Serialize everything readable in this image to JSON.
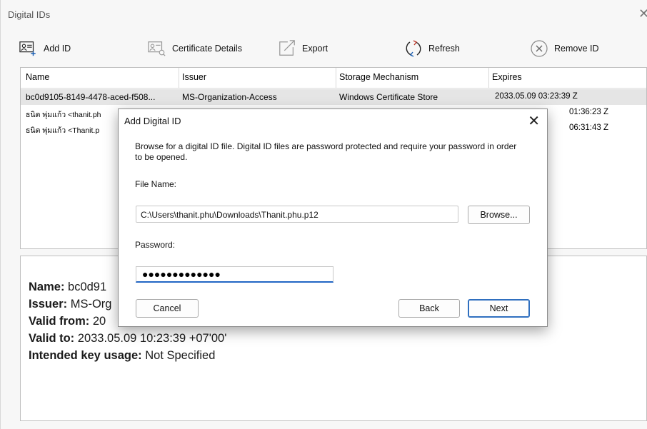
{
  "window": {
    "title": "Digital IDs",
    "close_glyph": "✕"
  },
  "toolbar": {
    "add_id": "Add ID",
    "certificate_details": "Certificate Details",
    "export": "Export",
    "refresh": "Refresh",
    "remove_id": "Remove ID"
  },
  "list": {
    "columns": [
      "Name",
      "Issuer",
      "Storage Mechanism",
      "Expires"
    ],
    "rows": [
      [
        "bc0d9105-8149-4478-aced-f508...",
        "MS-Organization-Access",
        "Windows Certificate Store",
        "2033.05.09 03:23:39 Z"
      ],
      [
        "ธนิต พุ่มแก้ว <thanit.ph",
        "",
        "",
        "01:36:23 Z"
      ],
      [
        "ธนิต พุ่มแก้ว <Thanit.p",
        "",
        "",
        "06:31:43 Z"
      ]
    ]
  },
  "details": {
    "name_label": "Name:",
    "name_value": "bc0d91",
    "issuer_label": "Issuer:",
    "issuer_value": "MS-Org",
    "valid_from_label": "Valid from:",
    "valid_from_value": "20",
    "valid_to_label": "Valid to:",
    "valid_to_value": "2033.05.09 10:23:39 +07'00'",
    "usage_label": "Intended key usage:",
    "usage_value": "Not Specified"
  },
  "dialog": {
    "title": "Add Digital ID",
    "close_glyph": "✕",
    "description": "Browse for a digital ID file. Digital ID files are password protected and require your password in order to be opened.",
    "file_name_label": "File Name:",
    "file_name_value": "C:\\Users\\thanit.phu\\Downloads\\Thanit.phu.p12",
    "browse_label": "Browse...",
    "password_label": "Password:",
    "password_value": "●●●●●●●●●●●●●",
    "cancel_label": "Cancel",
    "back_label": "Back",
    "next_label": "Next"
  },
  "colors": {
    "accent": "#2266c4",
    "selected_row": "#e5e5e5"
  }
}
